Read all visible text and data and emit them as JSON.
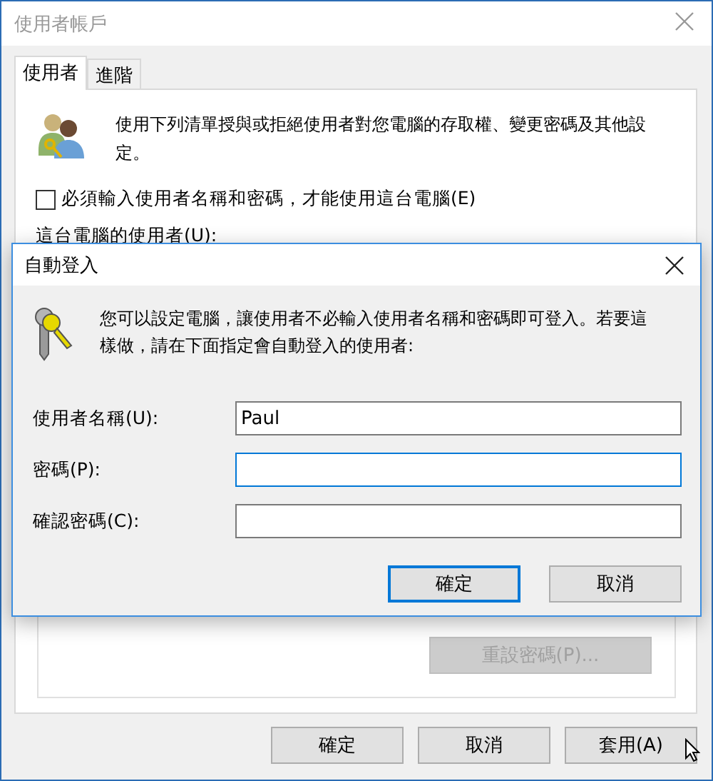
{
  "window": {
    "title": "使用者帳戶"
  },
  "tabs": [
    {
      "label": "使用者",
      "selected": true
    },
    {
      "label": "進階",
      "selected": false
    }
  ],
  "intro": "使用下列清單授與或拒絕使用者對您電腦的存取權、變更密碼及其他設定。",
  "require_login": {
    "label": "必須輸入使用者名稱和密碼，才能使用這台電腦(E)",
    "checked": false
  },
  "users_label": "這台電腦的使用者(U):",
  "reset_password": {
    "label": "重設密碼(P)...",
    "disabled": true
  },
  "buttons": [
    {
      "label": "確定",
      "default": false
    },
    {
      "label": "取消",
      "default": false
    },
    {
      "label": "套用(A)",
      "default": false
    }
  ],
  "dialog": {
    "title": "自動登入",
    "message": "您可以設定電腦，讓使用者不必輸入使用者名稱和密碼即可登入。若要這樣做，請在下面指定會自動登入的使用者:",
    "fields": [
      {
        "label": "使用者名稱(U):",
        "value": "Paul",
        "focused": false
      },
      {
        "label": "密碼(P):",
        "focused": true
      },
      {
        "label": "確認密碼(C):",
        "focused": false
      }
    ],
    "buttons": [
      {
        "label": "確定",
        "default": true
      },
      {
        "label": "取消",
        "default": false
      }
    ]
  }
}
